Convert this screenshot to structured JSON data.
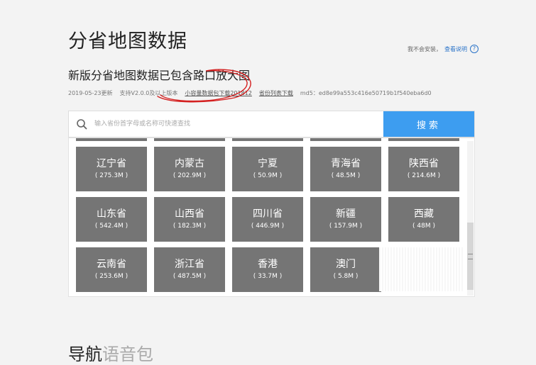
{
  "page": {
    "title": "分省地图数据",
    "help_text": "我不会安装，",
    "help_link": "查看说明",
    "help_icon": "?"
  },
  "download": {
    "title": "新版分省地图数据已包含路口放大图",
    "date": "2019-05-23更新",
    "support": "支持V2.0.0及以上版本",
    "small_pkg_link": "小容量数据包下载201812",
    "list_link": "省份列表下载",
    "md5": "md5：ed8e99a553c416e50719b1f540eba6d0"
  },
  "search": {
    "placeholder": "输入省份首字母或名称可快速查找",
    "button": "搜索"
  },
  "provinces": [
    {
      "name": "辽宁省",
      "size": "( 275.3M )"
    },
    {
      "name": "内蒙古",
      "size": "( 202.9M )"
    },
    {
      "name": "宁夏",
      "size": "( 50.9M )"
    },
    {
      "name": "青海省",
      "size": "( 48.5M )"
    },
    {
      "name": "陕西省",
      "size": "( 214.6M )"
    },
    {
      "name": "山东省",
      "size": "( 542.4M )"
    },
    {
      "name": "山西省",
      "size": "( 182.3M )"
    },
    {
      "name": "四川省",
      "size": "( 446.9M )"
    },
    {
      "name": "新疆",
      "size": "( 157.9M )"
    },
    {
      "name": "西藏",
      "size": "( 48M )"
    },
    {
      "name": "云南省",
      "size": "( 253.6M )"
    },
    {
      "name": "浙江省",
      "size": "( 487.5M )"
    },
    {
      "name": "香港",
      "size": "( 33.7M )"
    },
    {
      "name": "澳门",
      "size": "( 5.8M )"
    }
  ],
  "next_section": {
    "title": "导航",
    "title_muted": "语音包"
  },
  "colors": {
    "accent": "#3d9df0",
    "tile": "#757575",
    "link": "#2a73c8",
    "scribble": "#d42020"
  }
}
